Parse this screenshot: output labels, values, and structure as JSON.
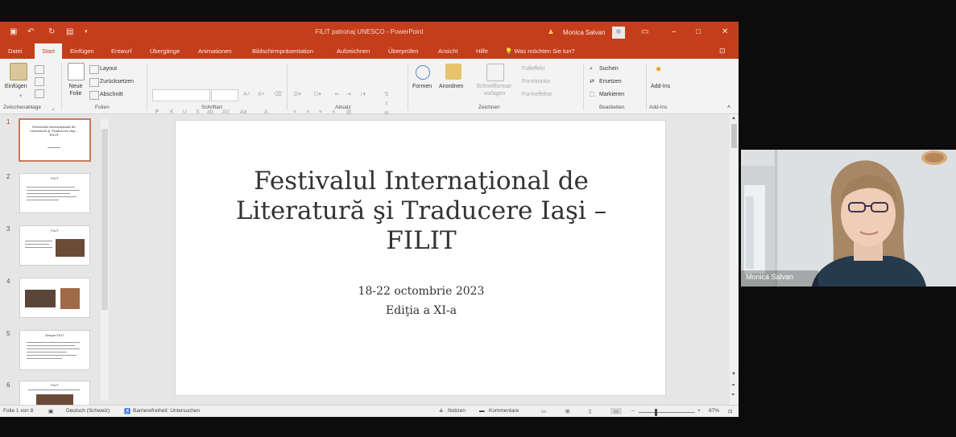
{
  "window": {
    "doc_title": "FILIT patronaj UNESCO - PowerPoint",
    "user": "Monica Salvan",
    "colors": {
      "accent": "#c43e1c",
      "ribbon_bg": "#f3f3f3",
      "workspace_bg": "#e6e6e6"
    }
  },
  "tabs": [
    "Datei",
    "Start",
    "Einfügen",
    "Entwurf",
    "Übergänge",
    "Animationen",
    "Bildschirmpräsentation",
    "Aufzeichnen",
    "Überprüfen",
    "Ansicht",
    "Hilfe"
  ],
  "active_tab": "Start",
  "tell_me": "Was möchten Sie tun?",
  "ribbon": {
    "paste": "Einfügen",
    "clipboard_group": "Zwischenablage",
    "new_slide": "Neue Folie",
    "layout": "Layout",
    "reset": "Zurücksetzen",
    "section": "Abschnitt",
    "slides_group": "Folien",
    "bold": "F",
    "italic": "K",
    "underline": "U",
    "shadow": "S",
    "font_group": "Schriftart",
    "paragraph_group": "Absatz",
    "shapes": "Formen",
    "arrange": "Anordnen",
    "quick_styles": "Schnellformat-vorlagen",
    "fill": "Fülleffekt",
    "outline": "Formkontur",
    "effects": "Formeffekte",
    "drawing_group": "Zeichnen",
    "find": "Suchen",
    "replace": "Ersetzen",
    "select": "Markieren",
    "editing_group": "Bearbeiten",
    "addins": "Add-Ins",
    "addins_group": "Add-Ins"
  },
  "thumbnails": [
    {
      "num": "1",
      "title": "Festivalul Internaţional de Literatură şi Traducere Iaşi – FILIT"
    },
    {
      "num": "2",
      "title": "FILIT"
    },
    {
      "num": "3",
      "title": "FILIT"
    },
    {
      "num": "4",
      "title": ""
    },
    {
      "num": "5",
      "title": "Despre FILIT"
    },
    {
      "num": "6",
      "title": "FILIT"
    }
  ],
  "slide": {
    "title_lines": [
      "Festivalul Internaţional de",
      "Literatură şi Traducere Iaşi –",
      "FILIT"
    ],
    "date": "18-22 octombrie 2023",
    "edition": "Ediţia a XI-a"
  },
  "status": {
    "slide_count": "Folie 1 von 8",
    "language": "Deutsch (Schweiz)",
    "accessibility": "Barrierefreiheit: Untersuchen",
    "notes": "Notizen",
    "comments": "Kommentare",
    "zoom": "67%"
  },
  "camera": {
    "participant": "Monica Salvan"
  }
}
